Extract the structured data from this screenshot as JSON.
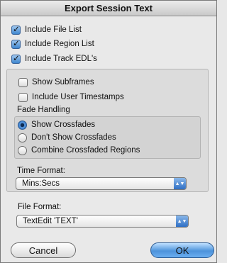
{
  "window": {
    "title": "Export Session Text"
  },
  "checks": [
    {
      "label": "Include File List",
      "checked": true
    },
    {
      "label": "Include Region List",
      "checked": true
    },
    {
      "label": "Include Track EDL's",
      "checked": true
    }
  ],
  "edl": {
    "show_subframes": {
      "label": "Show Subframes",
      "checked": false
    },
    "include_timestamps": {
      "label": "Include User Timestamps",
      "checked": false
    },
    "fade_heading": "Fade Handling",
    "fade_options": [
      {
        "label": "Show Crossfades",
        "selected": true
      },
      {
        "label": "Don't Show Crossfades",
        "selected": false
      },
      {
        "label": "Combine Crossfaded Regions",
        "selected": false
      }
    ],
    "time_format_label": "Time Format:",
    "time_format_value": "Mins:Secs"
  },
  "file_format_label": "File Format:",
  "file_format_value": "TextEdit 'TEXT'",
  "buttons": {
    "cancel": "Cancel",
    "ok": "OK"
  }
}
